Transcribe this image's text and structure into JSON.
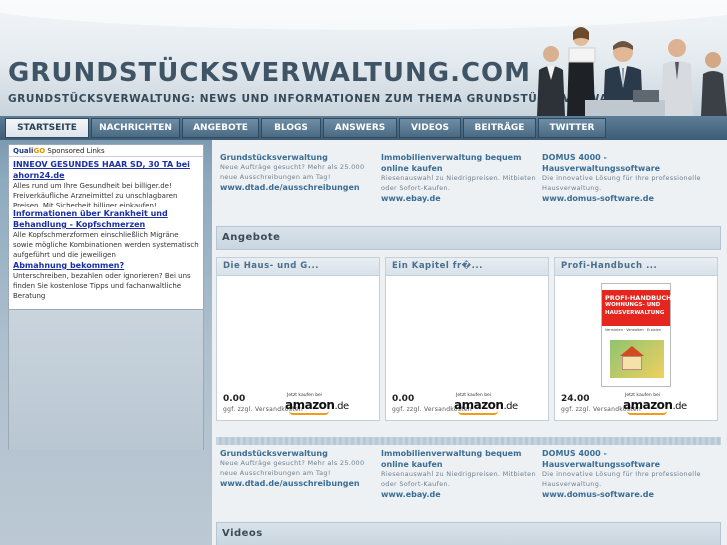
{
  "header": {
    "title": "GRUNDSTÜCKSVERWALTUNG.COM",
    "tagline": "GRUNDSTÜCKSVERWALTUNG: NEWS UND INFORMATIONEN ZUM THEMA GRUNDSTÜCKSVERWALTUNG"
  },
  "nav": {
    "tabs": [
      {
        "label": "STARTSEITE"
      },
      {
        "label": "NACHRICHTEN"
      },
      {
        "label": "ANGEBOTE"
      },
      {
        "label": "BLOGS"
      },
      {
        "label": "ANSWERS"
      },
      {
        "label": "VIDEOS"
      },
      {
        "label": "BEITRÄGE"
      },
      {
        "label": "TWITTER"
      }
    ]
  },
  "sidebar": {
    "ad_header": {
      "brand1": "Quali",
      "brand2": "GO",
      "label": " Sponsored Links"
    },
    "ads": [
      {
        "title": "INNEOV GESUNDES HAAR SD, 30 TA bei ahorn24.de",
        "text": "Alles rund um Ihre Gesundheit bei billiger.de! Freiverkäufliche Arzneimittel zu unschlagbaren Preisen. Mit Sicherheit billiger einkaufen!"
      },
      {
        "title": "Informationen über Krankheit und Behandlung - Kopfschmerzen",
        "text": "Alle Kopfschmerzformen einschließlich Migräne sowie mögliche Kombinationen werden systematisch aufgeführt und die jeweiligen Behandlungsmöglichkeiten ausführlich"
      },
      {
        "title": "Abmahnung bekommen?",
        "text": "Unterschreiben, bezahlen oder ignorieren? Bei uns finden Sie kostenlose Tipps und fachanwaltliche Beratung"
      }
    ]
  },
  "links_top": [
    {
      "title": "Grundstücksverwaltung",
      "text": "Neue Aufträge gesucht? Mehr als 25.000 neue Ausschreibungen am Tag!",
      "url": "www.dtad.de/ausschreibungen"
    },
    {
      "title": "Immobilienverwaltung bequem online kaufen",
      "text": "Riesenauswahl zu Niedrigpreisen. Mitbieten oder Sofort-Kaufen.",
      "url": "www.ebay.de"
    },
    {
      "title": "DOMUS 4000 - Hausverwaltungssoftware",
      "text": "Die innovative Lösung für Ihre professionelle Hausverwaltung.",
      "url": "www.domus-software.de"
    }
  ],
  "links_bottom": [
    {
      "title": "Grundstücksverwaltung",
      "text": "Neue Aufträge gesucht? Mehr als 25.000 neue Ausschreibungen am Tag!",
      "url": "www.dtad.de/ausschreibungen"
    },
    {
      "title": "Immobilienverwaltung bequem online kaufen",
      "text": "Riesenauswahl zu Niedrigpreisen. Mitbieten oder Sofort-Kaufen.",
      "url": "www.ebay.de"
    },
    {
      "title": "DOMUS 4000 - Hausverwaltungssoftware",
      "text": "Die innovative Lösung für Ihre professionelle Hausverwaltung.",
      "url": "www.domus-software.de"
    }
  ],
  "sections": {
    "angebote": "Angebote",
    "videos": "Videos"
  },
  "products": [
    {
      "title": "Die Haus- und G...",
      "price": "0.00",
      "shipping": "ggf. zzgl. Versandkosten"
    },
    {
      "title": "Ein Kapitel fr�...",
      "price": "0.00",
      "shipping": "ggf. zzgl. Versandkosten"
    },
    {
      "title": "Profi-Handbuch ...",
      "price": "24.00",
      "shipping": "ggf. zzgl. Versandkosten"
    }
  ],
  "amazon": {
    "small": "Jetzt kaufen bei",
    "logo": "amazon",
    "tld": ".de"
  },
  "book_cover": {
    "line1": "PROFI-HANDBUCH",
    "line2": "WOHNUNGS- UND",
    "line3": "HAUSVERWALTUNG",
    "sub": "Vermieten · Verwalten · Erzielen"
  },
  "colors": {
    "nav": "#4a6a84",
    "link": "#3a6d95",
    "sidebar": "#8eaabf",
    "amazon_smile": "#f29a1a"
  }
}
